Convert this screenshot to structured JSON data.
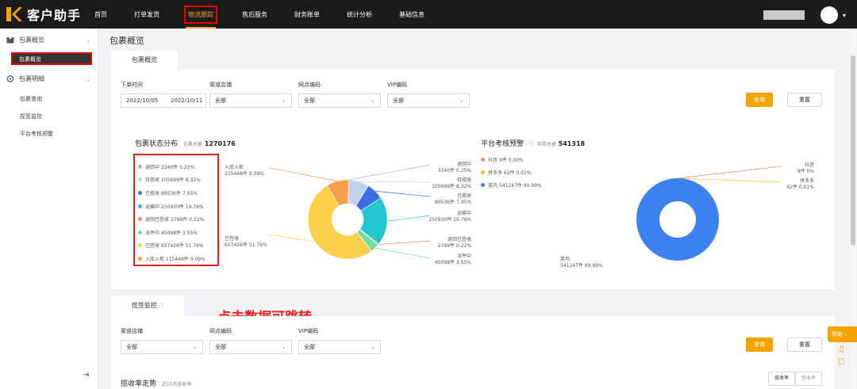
{
  "app": {
    "title": "客户助手"
  },
  "nav": {
    "items": [
      "首页",
      "打单发货",
      "物流跟踪",
      "售后服务",
      "财务账单",
      "统计分析",
      "基础信息"
    ],
    "active": "物流跟踪"
  },
  "sidebar": {
    "group1": "包裹概览",
    "item_active": "包裹概览",
    "group2": "包裹明细",
    "items": [
      "包裹查询",
      "揽签监控",
      "平台考核预警"
    ]
  },
  "page": {
    "title": "包裹概览",
    "tab": "包裹概览"
  },
  "filters": {
    "date_label": "下单时间",
    "date_start": "2022/10/05",
    "date_end": "2022/10/11",
    "channel_label": "渠道店铺",
    "channel_value": "全部",
    "outlet_label": "网点编码",
    "outlet_value": "全部",
    "vip_label": "VIP编码",
    "vip_value": "全部",
    "query": "查询",
    "reset": "重置"
  },
  "status_chart": {
    "title": "包裹状态分布",
    "total_label": "包裹总量",
    "total": "1270176",
    "items": [
      {
        "name": "退回中",
        "text": "退回中 3240件 0.25%",
        "value": 3240,
        "color": "#9fb3d9"
      },
      {
        "name": "待揽收",
        "text": "待揽收 105699件 8.32%",
        "value": 105699,
        "color": "#c5d2ee"
      },
      {
        "name": "已揽收",
        "text": "已揽收 89536件 7.05%",
        "value": 89536,
        "color": "#3b6fe0"
      },
      {
        "name": "运输中",
        "text": "运输中 250930件 19.76%",
        "value": 250930,
        "color": "#1fc7cf"
      },
      {
        "name": "退回已签收",
        "text": "退回已签收 2799件 0.22%",
        "value": 2799,
        "color": "#f08a6a"
      },
      {
        "name": "派件中",
        "text": "派件中 45098件 3.55%",
        "value": 45098,
        "color": "#6ee0a0"
      },
      {
        "name": "已签收",
        "text": "已签收 657426件 51.76%",
        "value": 657426,
        "color": "#fbd14b"
      },
      {
        "name": "入库入柜",
        "text": "入库入柜 115448件 9.09%",
        "value": 115448,
        "color": "#f59f4b"
      }
    ],
    "annotations": [
      {
        "name": "入库入柜",
        "value": "115448件 9.09%"
      },
      {
        "name": "已签收",
        "value": "657426件 51.76%"
      },
      {
        "name": "退回中",
        "value": "3240件 0.25%"
      },
      {
        "name": "待揽收",
        "value": "105699件 8.32%"
      },
      {
        "name": "已揽收",
        "value": "89536件 7.05%"
      },
      {
        "name": "运输中",
        "value": "250930件 19.76%"
      },
      {
        "name": "退回已签收",
        "value": "2799件 0.22%"
      },
      {
        "name": "派件中",
        "value": "45098件 3.55%"
      }
    ]
  },
  "hint": "点击数据可跳转",
  "platform_chart": {
    "title": "平台考核预警",
    "total_label": "异常总量",
    "total": "541318",
    "items": [
      {
        "name": "抖音",
        "text": "抖音 9件 0.00%",
        "value": 9,
        "color": "#f08a6a"
      },
      {
        "name": "拼多多",
        "text": "拼多多 62件 0.01%",
        "value": 62,
        "color": "#fbc02d"
      },
      {
        "name": "菜鸟",
        "text": "菜鸟 541247件 99.99%",
        "value": 541247,
        "color": "#3b82f0"
      }
    ],
    "annotations": [
      {
        "name": "抖音",
        "value": "9件 0%"
      },
      {
        "name": "拼多多",
        "value": "62件 0.01%"
      },
      {
        "name": "菜鸟",
        "value": "541247件 99.99%"
      }
    ]
  },
  "section2": {
    "tab": "揽签监控",
    "trend_title": "揽收率走势",
    "trend_sub": "近15天揽收率",
    "seg": [
      "揽收率",
      "签收率"
    ]
  },
  "help": {
    "label": "帮助"
  },
  "colors": {
    "accent": "#f5a300",
    "highlight": "#e00000"
  }
}
